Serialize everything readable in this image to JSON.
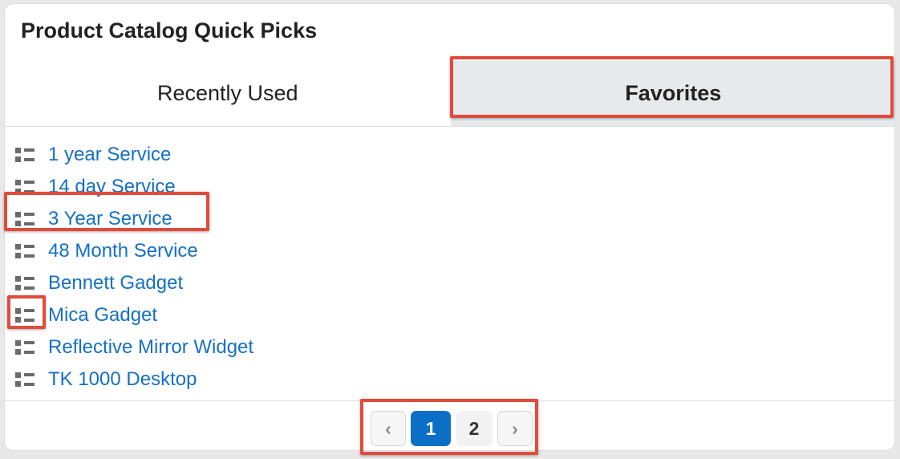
{
  "panel": {
    "title": "Product Catalog Quick Picks"
  },
  "tabs": [
    {
      "label": "Recently Used",
      "active": false
    },
    {
      "label": "Favorites",
      "active": true
    }
  ],
  "items": [
    {
      "label": "1 year Service"
    },
    {
      "label": "14 day Service"
    },
    {
      "label": "3 Year Service"
    },
    {
      "label": "48 Month Service"
    },
    {
      "label": "Bennett Gadget"
    },
    {
      "label": "Mica Gadget"
    },
    {
      "label": "Reflective Mirror Widget"
    },
    {
      "label": "TK 1000 Desktop"
    }
  ],
  "pagination": {
    "prev": "‹",
    "pages": [
      "1",
      "2"
    ],
    "current": "1",
    "next": "›"
  },
  "icons": {
    "item": "drag-handle-icon",
    "prev": "chevron-left-icon",
    "next": "chevron-right-icon"
  },
  "colors": {
    "link": "#1470c3",
    "active_tab_bg": "#e7eaed",
    "current_page_bg": "#0b6fc6",
    "highlight_border": "#e24b3b"
  }
}
